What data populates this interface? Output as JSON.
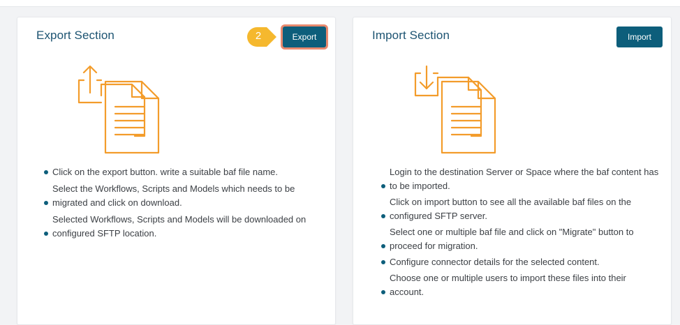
{
  "export": {
    "title": "Export Section",
    "button_label": "Export",
    "step_badge": "2",
    "items": [
      "Click on the export button. write a suitable baf file name.",
      "Select the Workflows, Scripts and Models which needs to be migrated and click on download.",
      "Selected Workflows, Scripts and Models will be downloaded on configured SFTP location."
    ],
    "icon": "export-document-icon"
  },
  "import": {
    "title": "Import Section",
    "button_label": "Import",
    "items": [
      "Login to the destination Server or Space where the baf content has to be imported.",
      "Click on import button to see all the available baf files on the configured SFTP server.",
      "Select one or multiple baf file and click on \"Migrate\" button to proceed for migration.",
      "Configure connector details for the selected content.",
      "Choose one or multiple users to import these files into their account."
    ],
    "icon": "import-document-icon"
  },
  "colors": {
    "accent": "#0d5e7b",
    "title": "#1d5472",
    "icon": "#f39c2b",
    "badge": "#f5b82e",
    "highlight": "#e8896e"
  }
}
